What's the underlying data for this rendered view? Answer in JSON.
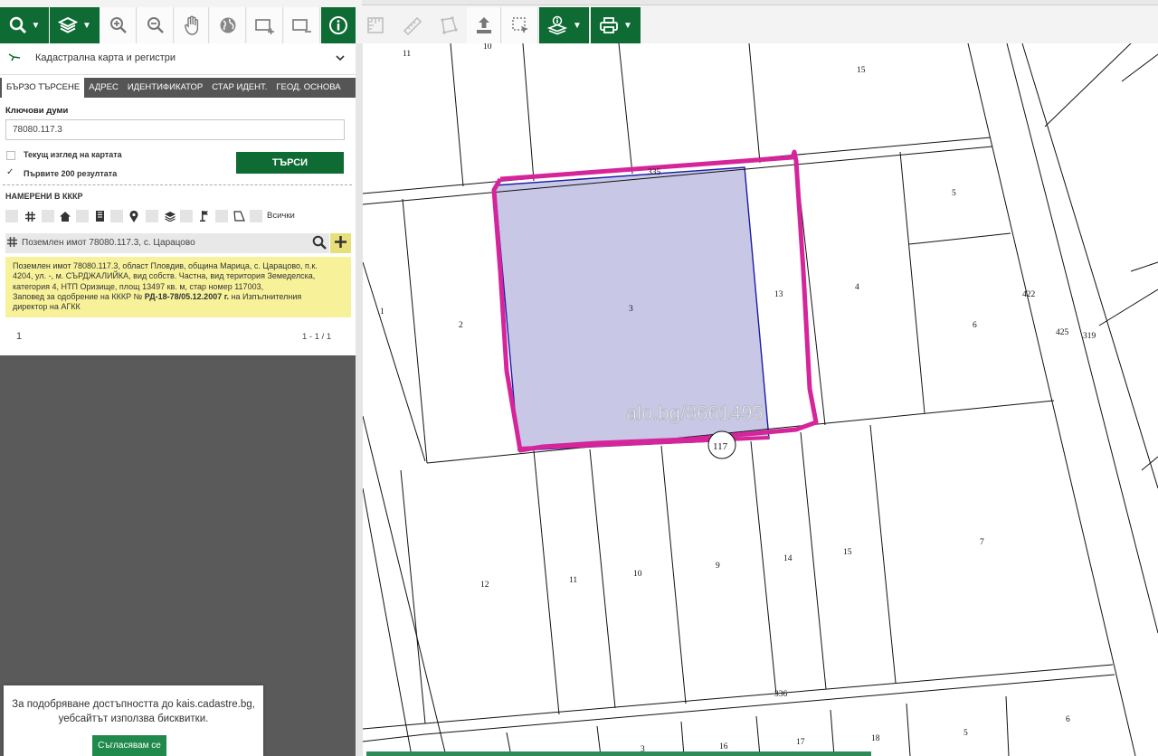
{
  "toolbar": {
    "buttons": [
      {
        "name": "search-tool",
        "icon": "search-icon",
        "dropdown": true,
        "style": "green"
      },
      {
        "name": "layers-tool",
        "icon": "layers-icon",
        "dropdown": true,
        "style": "green"
      },
      {
        "name": "zoom-in-tool",
        "icon": "zoom-in-icon",
        "style": "light"
      },
      {
        "name": "zoom-out-tool",
        "icon": "zoom-out-icon",
        "style": "light"
      },
      {
        "name": "pan-tool",
        "icon": "hand-icon",
        "style": "light"
      },
      {
        "name": "full-extent-tool",
        "icon": "globe-icon",
        "style": "light"
      },
      {
        "name": "next-extent-tool",
        "icon": "extent-next-icon",
        "style": "light"
      },
      {
        "name": "prev-extent-tool",
        "icon": "extent-prev-icon",
        "style": "light"
      },
      {
        "name": "identify-tool",
        "icon": "info-icon",
        "style": "green"
      },
      {
        "name": "measure-area-tool",
        "icon": "ruler-area-icon",
        "style": "disabled"
      },
      {
        "name": "measure-length-tool",
        "icon": "ruler-icon",
        "style": "disabled"
      },
      {
        "name": "polygon-tool",
        "icon": "polygon-icon",
        "style": "disabled"
      },
      {
        "name": "upload-tool",
        "icon": "upload-icon",
        "style": "light"
      },
      {
        "name": "select-tool",
        "icon": "select-box-icon",
        "style": "light"
      },
      {
        "name": "layer-info-tool",
        "icon": "layer-info-icon",
        "dropdown": true,
        "style": "green"
      },
      {
        "name": "print-tool",
        "icon": "print-icon",
        "dropdown": true,
        "style": "green"
      }
    ],
    "colors": {
      "green": "#0e6b34",
      "light": "#fbfbfb"
    }
  },
  "panel": {
    "layer_select": "Кадастрална карта и регистри",
    "tabs": [
      "БЪРЗО ТЪРСЕНЕ",
      "АДРЕС",
      "ИДЕНТИФИКАТОР",
      "СТАР ИДЕНТ.",
      "ГЕОД. ОСНОВА"
    ],
    "keywords_label": "Ключови думи",
    "keywords_value": "78080.117.3",
    "current_view_label": "Текущ изглед на картата",
    "first_200_label": "Първите 200 резултата",
    "first_200_checked": true,
    "search_button": "ТЪРСИ",
    "found_title": "НАМЕРЕНИ В КККР",
    "filter_icons": [
      "grid-icon",
      "home-icon",
      "building-icon",
      "pin-icon",
      "layers-icon",
      "flag-icon",
      "polygon-icon"
    ],
    "all_label": "Всички",
    "result_title": "Поземлен имот 78080.117.3, с. Царацово",
    "result_detail_lines": [
      "Поземлен имот 78080.117.3, област Пловдив, община Марица, с. Царацово, п.к.",
      "4204, ул. -, м. СЪРДЖАЛИЙКА, вид собств. Частна, вид територия Земеделска,",
      "категория 4, НТП Оризище, площ 13497 кв. м, стар номер 117003,"
    ],
    "result_detail_order_prefix": "Заповед за одобрение на КККР № ",
    "result_detail_order_number": "РД-18-78/05.12.2007 г.",
    "result_detail_order_suffix": " на Изпълнителния",
    "result_detail_last_line": "директор на АГКК",
    "pager_page": "1",
    "pager_range": "1 - 1 / 1",
    "highlight_color": "#f7f29a"
  },
  "cookie": {
    "text_line1": "За подобряване достъпността до kais.cadastre.bg,",
    "text_line2": "уебсайтът използва бисквитки.",
    "button": "Съгласявам се"
  },
  "map": {
    "watermark": "alo.bg/8661495",
    "selected_parcel_color": "#c8c8e6",
    "highlight_stroke_color": "#d6249b",
    "labels": {
      "p11top": "11",
      "p10top": "10",
      "p15top": "15",
      "p5": "5",
      "p1": "1",
      "p2": "2",
      "p3": "3",
      "p13": "13",
      "p4": "4",
      "p6": "6",
      "s422": "422",
      "s425": "425",
      "s319": "319",
      "r335": "335",
      "b117": "117",
      "p12": "12",
      "p11": "11",
      "p10": "10",
      "p9": "9",
      "p14": "14",
      "p15": "15",
      "p7": "7",
      "r336": "336",
      "p3b": "3",
      "p16": "16",
      "p17": "17",
      "p18": "18",
      "p5b": "5",
      "p6b": "6"
    }
  }
}
